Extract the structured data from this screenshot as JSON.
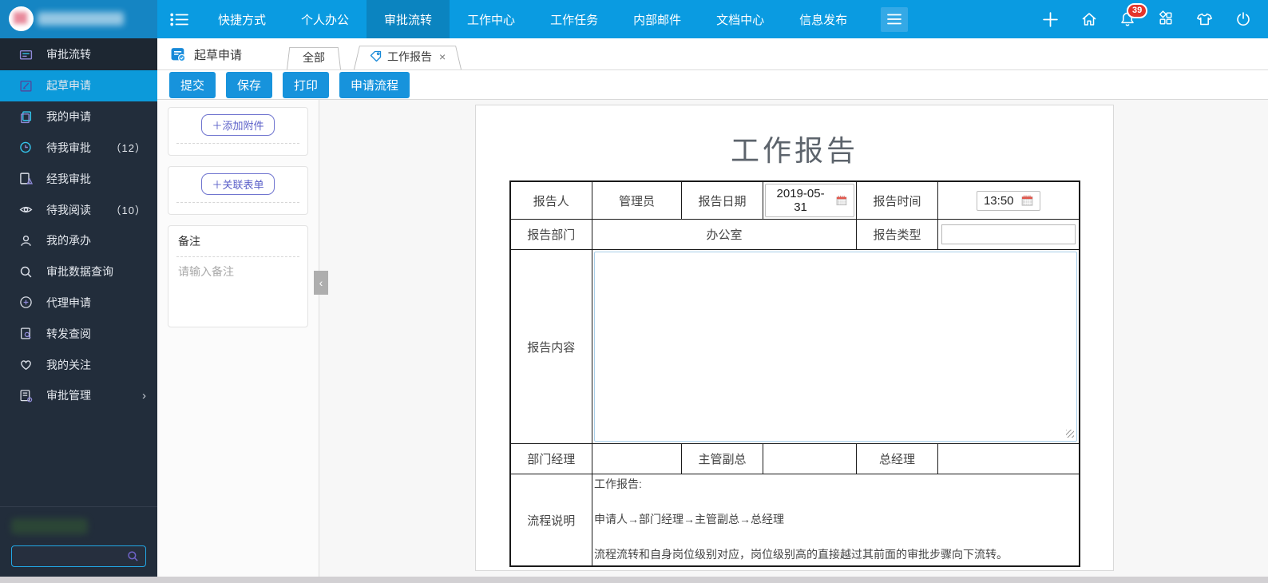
{
  "colors": {
    "topbar_blue": "#0a9be1",
    "logo_area_blue": "#1585c3",
    "active_nav_blue": "#0b84c0",
    "sidebar_dark": "#222d3b",
    "active_item_blue": "#0c9ada",
    "button_blue": "#1793dc",
    "badge_red": "#e5352b",
    "table_border": "#1a1a1a",
    "textarea_border": "#a9cfe9"
  },
  "icons": {
    "close": "×",
    "chevron_right": "›",
    "chevron_left": "‹"
  },
  "topbar": {
    "nav": [
      {
        "label": "快捷方式"
      },
      {
        "label": "个人办公"
      },
      {
        "label": "审批流转"
      },
      {
        "label": "工作中心"
      },
      {
        "label": "工作任务"
      },
      {
        "label": "内部邮件"
      },
      {
        "label": "文档中心"
      },
      {
        "label": "信息发布"
      }
    ],
    "notification_badge": "39"
  },
  "sidebar": {
    "items": [
      {
        "label": "审批流转",
        "count": ""
      },
      {
        "label": "起草申请",
        "count": ""
      },
      {
        "label": "我的申请",
        "count": ""
      },
      {
        "label": "待我审批",
        "count": "（12）"
      },
      {
        "label": "经我审批",
        "count": ""
      },
      {
        "label": "待我阅读",
        "count": "（10）"
      },
      {
        "label": "我的承办",
        "count": ""
      },
      {
        "label": "审批数据查询",
        "count": ""
      },
      {
        "label": "代理申请",
        "count": ""
      },
      {
        "label": "转发查阅",
        "count": ""
      },
      {
        "label": "我的关注",
        "count": ""
      },
      {
        "label": "审批管理",
        "count": ""
      }
    ],
    "search_value": ""
  },
  "tabbar": {
    "module_title": "起草申请",
    "tabs": [
      {
        "label": "全部"
      },
      {
        "label": "工作报告"
      }
    ]
  },
  "toolbar": {
    "submit": "提交",
    "save": "保存",
    "print": "打印",
    "flow": "申请流程"
  },
  "side_panel": {
    "add_attachment": "＋添加附件",
    "link_form": "＋关联表单",
    "remark_title": "备注",
    "remark_placeholder": "请输入备注"
  },
  "form": {
    "title": "工作报告",
    "reporter_label": "报告人",
    "reporter_value": "管理员",
    "date_label": "报告日期",
    "date_value": "2019-05-31",
    "time_label": "报告时间",
    "time_value": "13:50",
    "dept_label": "报告部门",
    "dept_value": "办公室",
    "type_label": "报告类型",
    "content_label": "报告内容",
    "dept_manager_label": "部门经理",
    "deputy_manager_label": "主管副总",
    "gm_label": "总经理",
    "process_label": "流程说明",
    "process_lines": [
      "工作报告:",
      "申请人→部门经理→主管副总→总经理",
      "流程流转和自身岗位级别对应，岗位级别高的直接越过其前面的审批步骤向下流转。"
    ]
  }
}
